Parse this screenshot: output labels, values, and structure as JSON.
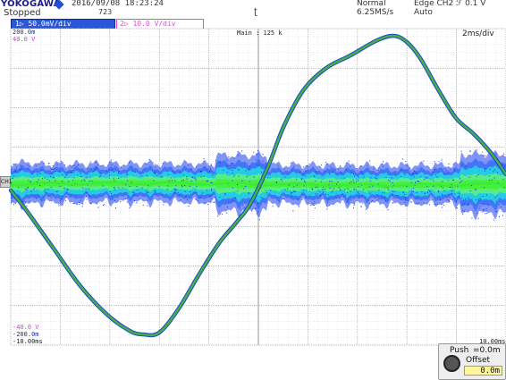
{
  "header": {
    "brand": "YOKOGAWA",
    "state": "Stopped",
    "datetime": "2016/09/08 18:23:24",
    "acq_count": "723",
    "acq_mode": "Normal",
    "sample_rate": "6.25MS/s",
    "trigger": "Edge CH2 ℱ 0.1 V",
    "trigger_mode": "Auto",
    "trigger_icon": "ᴛ"
  },
  "channels": {
    "ch1": {
      "label": "50.0mV/div",
      "suffix": "ₙₘ",
      "color": "#2a56d9",
      "top": "200.0m",
      "bottom": "-200.0m"
    },
    "ch2": {
      "label": "10.0 V/div",
      "color": "#e24bd3",
      "top": "40.0 V",
      "bottom": "-40.0 V"
    }
  },
  "display": {
    "main_label": "Main : 125 k",
    "timebase": "2ms/div",
    "left_time": "-10.00ms",
    "right_time": "10.00ms",
    "ch1_marker": "CH1"
  },
  "knob": {
    "push_label": "Push",
    "push_value": "=0.0m",
    "offset_label": "Offset",
    "offset_value": "0.0m"
  },
  "colors": {
    "grid_bg": "#ffffff",
    "grid_line": "#bfbfbf",
    "ch1_noise_outer": "#1a3cf0",
    "ch1_noise_inner": "#20d9e0",
    "ch1_core": "#44f03a",
    "ch2_trace": "#46b040"
  }
}
